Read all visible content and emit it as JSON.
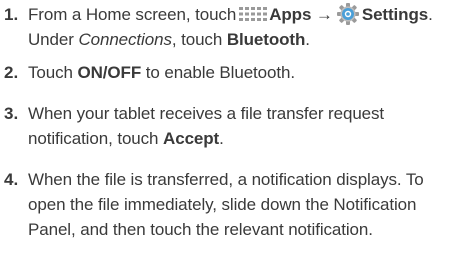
{
  "icons": {
    "apps": "apps-grid-icon",
    "settings": "settings-gear-icon"
  },
  "colors": {
    "text": "#3a3a3a",
    "apps_icon": "#9a9a9a",
    "settings_blue": "#4a9fd8"
  },
  "steps": [
    {
      "number": "1.",
      "lines": [
        {
          "t1": "From a Home screen, touch",
          "apps": "Apps →",
          "settings": "Settings",
          "end": "."
        },
        {
          "t1": "Under ",
          "section": "Connections",
          "t2": ", touch ",
          "target": "Bluetooth",
          "end": "."
        }
      ]
    },
    {
      "number": "2.",
      "lines": [
        {
          "t1": "Touch ",
          "target": "ON/OFF",
          "t2": " to enable Bluetooth."
        }
      ]
    },
    {
      "number": "3.",
      "lines": [
        {
          "text": "When your tablet receives a file transfer request"
        },
        {
          "t1": "notification, touch ",
          "target": "Accept",
          "end": "."
        }
      ]
    },
    {
      "number": "4.",
      "lines": [
        {
          "text": "When the file is transferred, a notification displays. To"
        },
        {
          "text": "open the file immediately, slide down the Notification"
        },
        {
          "text": "Panel, and then touch the relevant notification."
        }
      ]
    }
  ]
}
